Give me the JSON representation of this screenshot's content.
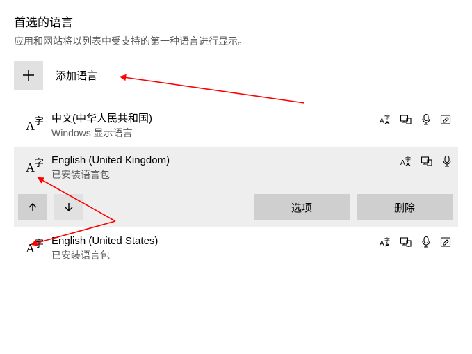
{
  "section": {
    "title": "首选的语言",
    "description": "应用和网站将以列表中受支持的第一种语言进行显示。",
    "add_label": "添加语言"
  },
  "languages": [
    {
      "name": "中文(中华人民共和国)",
      "sub": "Windows 显示语言",
      "features": {
        "tts": true,
        "display": true,
        "speech": true,
        "handwriting": true
      },
      "selected": false
    },
    {
      "name": "English (United Kingdom)",
      "sub": "已安装语言包",
      "features": {
        "tts": true,
        "display": true,
        "speech": true,
        "handwriting": false
      },
      "selected": true
    },
    {
      "name": "English (United States)",
      "sub": "已安装语言包",
      "features": {
        "tts": true,
        "display": true,
        "speech": true,
        "handwriting": true
      },
      "selected": false
    }
  ],
  "actions": {
    "options": "选项",
    "remove": "删除"
  }
}
